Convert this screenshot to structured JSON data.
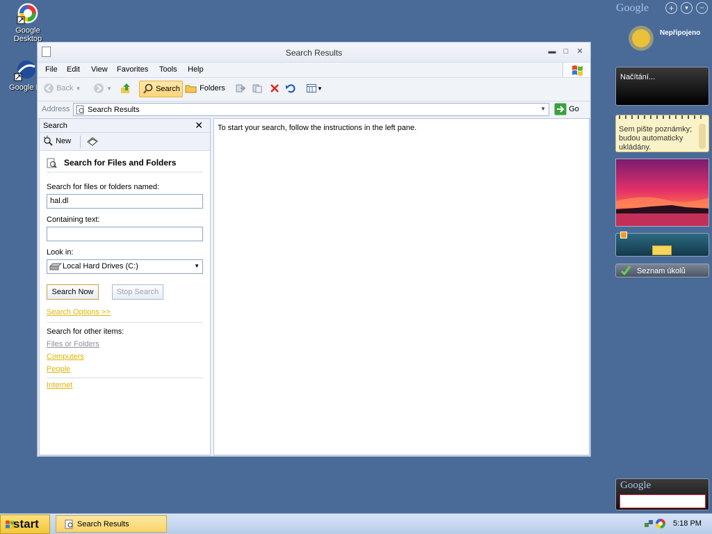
{
  "desktop": {
    "icons": [
      {
        "label": "Google Desktop"
      },
      {
        "label": "Google E"
      }
    ]
  },
  "window": {
    "title": "Search Results",
    "menu": [
      "File",
      "Edit",
      "View",
      "Favorites",
      "Tools",
      "Help"
    ],
    "toolbar": {
      "back": "Back",
      "search": "Search",
      "folders": "Folders"
    },
    "address": {
      "label": "Address",
      "value": "Search Results",
      "go": "Go"
    }
  },
  "left_pane": {
    "header": "Search",
    "new_label": "New",
    "section_title": "Search for Files and Folders",
    "named_label": "Search for files or folders named:",
    "named_value": "hal.dl",
    "containing_label": "Containing text:",
    "containing_value": "",
    "lookin_label": "Look in:",
    "lookin_value": "Local Hard Drives (C:)",
    "search_now": "Search Now",
    "stop_search": "Stop Search",
    "search_options": "Search Options >>",
    "other_items_label": "Search for other items:",
    "other_links": [
      "Files or Folders",
      "Computers",
      "People"
    ],
    "internet": "Internet"
  },
  "right_pane": {
    "message": "To start your search, follow the instructions in the left pane."
  },
  "sidebar": {
    "google_logo": "Google",
    "weather_status": "Nepřipojeno",
    "news_status": "Načítání...",
    "notes_text": "Sem pište poznámky; budou automaticky ukládány.",
    "tasks_label": "Seznam úkolů",
    "google_search_logo": "Google",
    "search_value": ""
  },
  "taskbar": {
    "start_label": "start",
    "task_label": "Search Results",
    "clock": "5:18 PM"
  },
  "colors": {
    "desktop": "#4a6a97",
    "link_yellow": "#e0b400",
    "start_yellow": "#f3c53c"
  }
}
